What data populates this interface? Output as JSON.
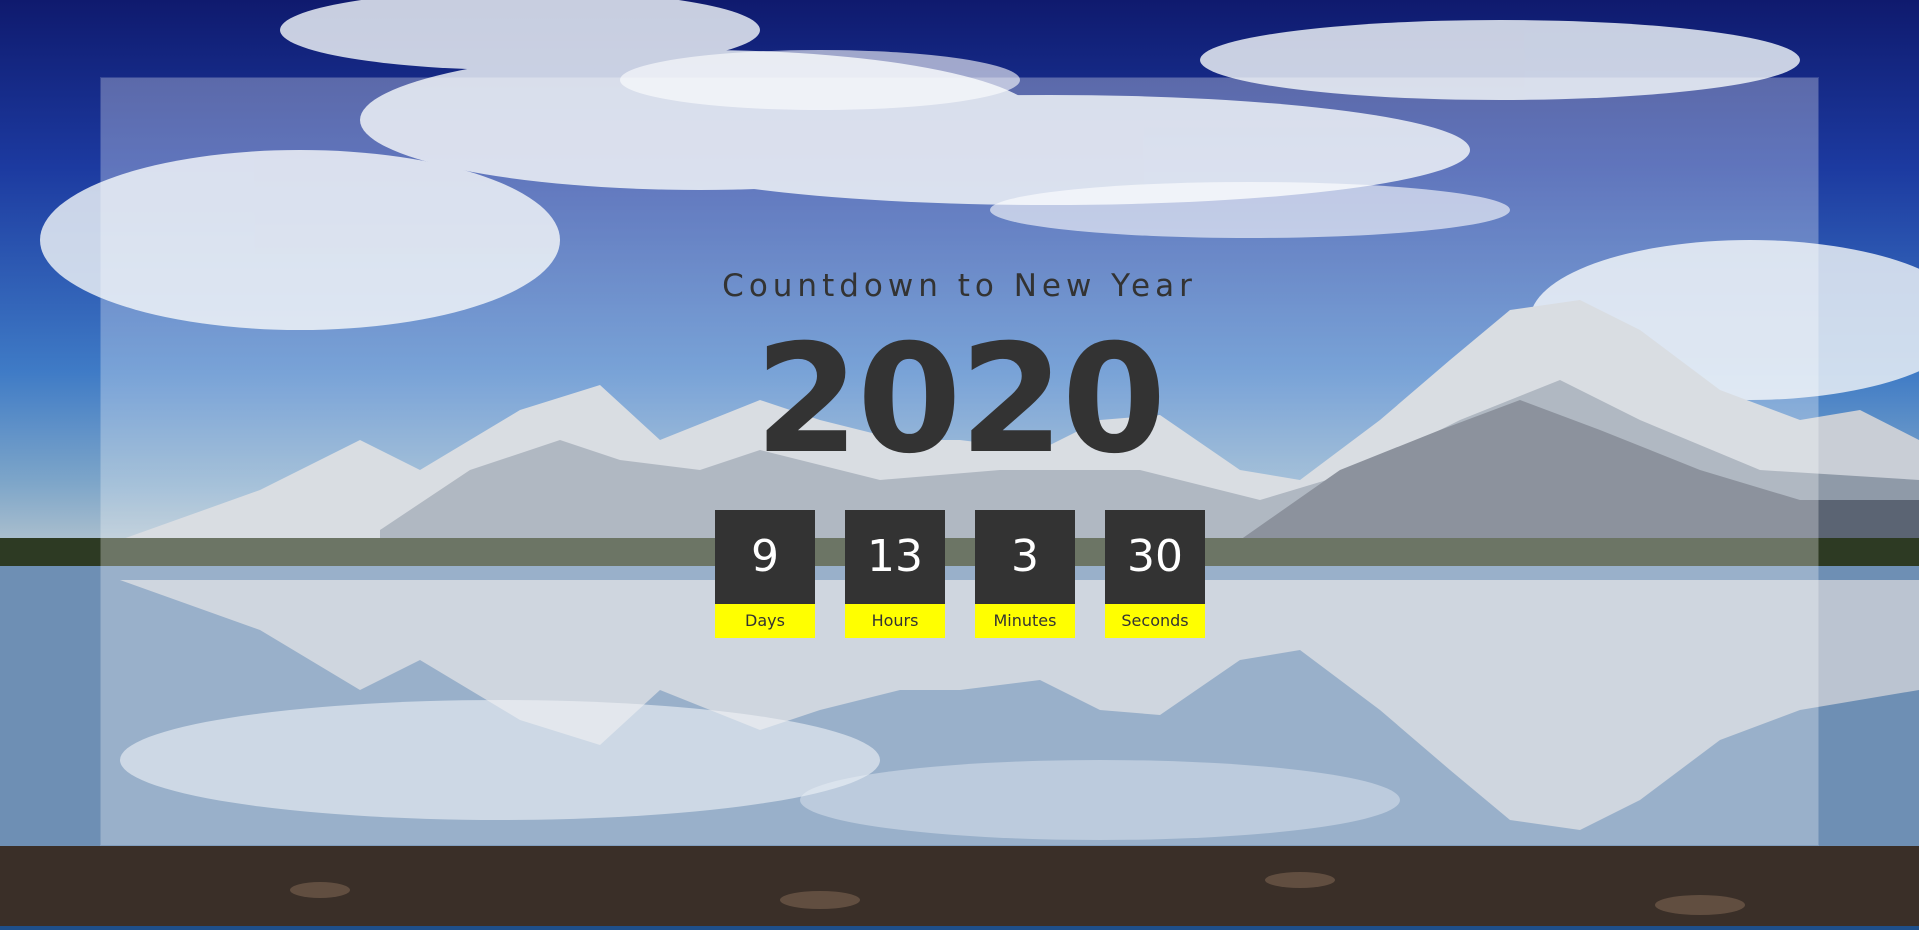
{
  "page": {
    "subtitle": "Countdown to New Year",
    "year": "2020"
  },
  "countdown": [
    {
      "value": "9",
      "label": "Days"
    },
    {
      "value": "13",
      "label": "Hours"
    },
    {
      "value": "3",
      "label": "Minutes"
    },
    {
      "value": "30",
      "label": "Seconds"
    }
  ],
  "colors": {
    "text_dark": "#333333",
    "label_bg": "#ffff00",
    "panel_overlay": "rgba(255,255,255,0.30)"
  }
}
